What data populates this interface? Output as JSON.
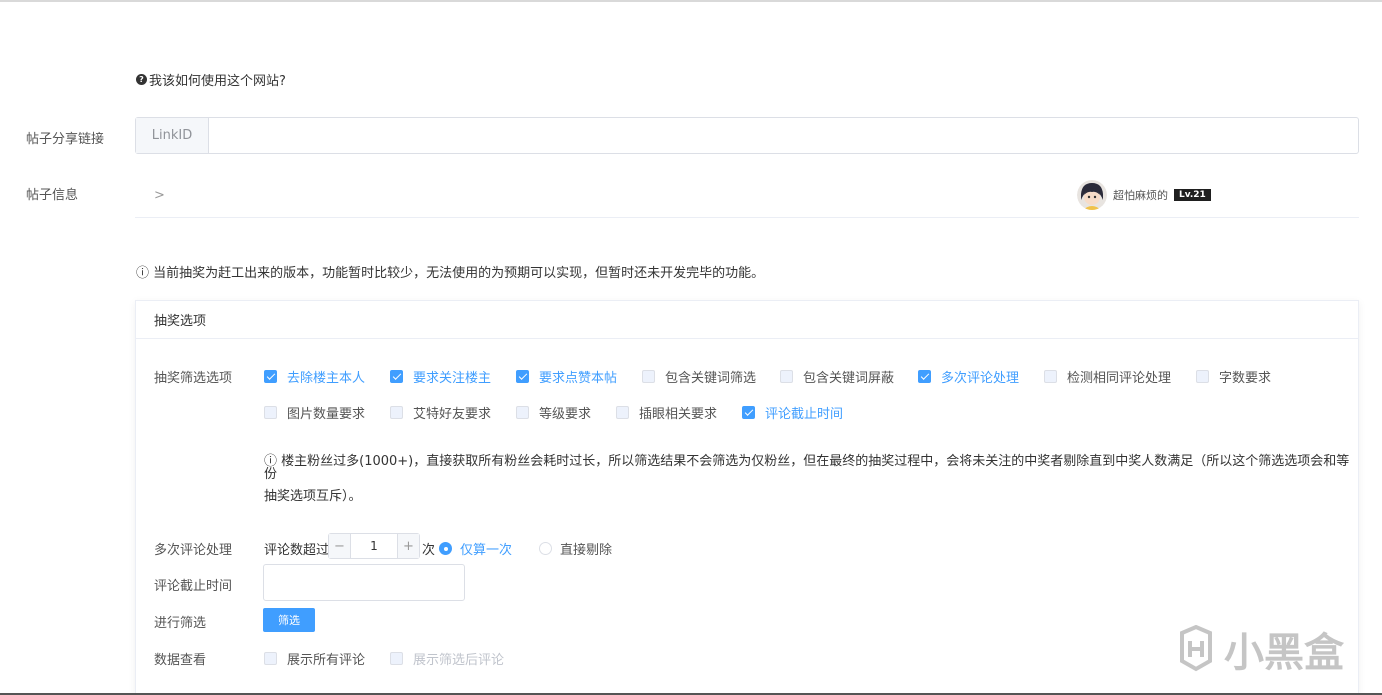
{
  "help": {
    "text": "我该如何使用这个网站?",
    "icon": "question-circle-icon"
  },
  "link": {
    "label": "帖子分享链接",
    "prepend": "LinkID",
    "value": "",
    "placeholder": ""
  },
  "post": {
    "label": "帖子信息",
    "chevron": ">",
    "author": "超怕麻烦的",
    "level": "Lv.21"
  },
  "notice": "ⓘ 当前抽奖为赶工出来的版本，功能暂时比较少，无法使用的为预期可以实现，但暂时还未开发完毕的功能。",
  "card": {
    "title": "抽奖选项",
    "filter_label": "抽奖筛选选项",
    "options_row1": [
      {
        "label": "去除楼主本人",
        "checked": true
      },
      {
        "label": "要求关注楼主",
        "checked": true
      },
      {
        "label": "要求点赞本帖",
        "checked": true
      },
      {
        "label": "包含关键词筛选",
        "checked": false
      },
      {
        "label": "包含关键词屏蔽",
        "checked": false
      },
      {
        "label": "多次评论处理",
        "checked": true
      },
      {
        "label": "检测相同评论处理",
        "checked": false
      },
      {
        "label": "字数要求",
        "checked": false
      }
    ],
    "options_row2": [
      {
        "label": "图片数量要求",
        "checked": false
      },
      {
        "label": "艾特好友要求",
        "checked": false
      },
      {
        "label": "等级要求",
        "checked": false
      },
      {
        "label": "插眼相关要求",
        "checked": false
      },
      {
        "label": "评论截止时间",
        "checked": true
      }
    ],
    "tip_line1": "ⓘ 楼主粉丝过多(1000+)，直接获取所有粉丝会耗时过长，所以筛选结果不会筛选为仅粉丝，但在最终的抽奖过程中，会将未关注的中奖者剔除直到中奖人数满足（所以这个筛选选项会和等份",
    "tip_line2": "抽奖选项互斥）。",
    "multi": {
      "label": "多次评论处理",
      "prefix": "评论数超过",
      "minus": "−",
      "value": "1",
      "plus": "+",
      "suffix": "次",
      "radio1": "仅算一次",
      "radio2": "直接剔除"
    },
    "deadline_label": "评论截止时间",
    "deadline_value": "",
    "run_label": "进行筛选",
    "run_button": "筛选",
    "view_label": "数据查看",
    "view_all": "展示所有评论",
    "view_filtered": "展示筛选后评论"
  },
  "watermark": "小黑盒",
  "colors": {
    "accent": "#409eff",
    "border": "#dcdfe6",
    "text": "#333333"
  }
}
